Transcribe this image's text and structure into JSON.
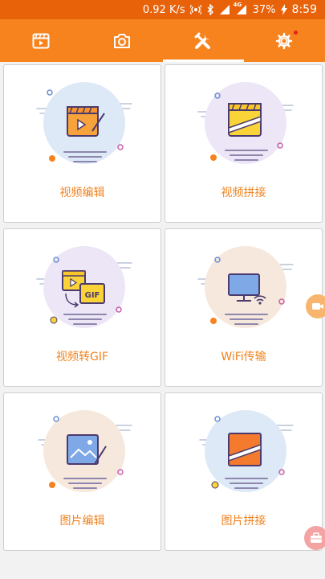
{
  "status_bar": {
    "speed": "0.92 K/s",
    "network": "4G",
    "battery": "37%",
    "time": "8:59"
  },
  "tabs": [
    {
      "icon": "video-clapper-icon",
      "active": false
    },
    {
      "icon": "camera-icon",
      "active": false
    },
    {
      "icon": "tools-icon",
      "active": true
    },
    {
      "icon": "settings-icon",
      "active": false,
      "badge": true
    }
  ],
  "cards": [
    {
      "label": "视频编辑",
      "icon": "video-edit-icon",
      "circle": "#dde9f7"
    },
    {
      "label": "视频拼接",
      "icon": "video-merge-icon",
      "circle": "#ece6f7"
    },
    {
      "label": "视频转GIF",
      "icon": "video-to-gif-icon",
      "circle": "#ece6f7"
    },
    {
      "label": "WiFi传输",
      "icon": "wifi-transfer-icon",
      "circle": "#f6e8dc"
    },
    {
      "label": "图片编辑",
      "icon": "image-edit-icon",
      "circle": "#f6e8dc"
    },
    {
      "label": "图片拼接",
      "icon": "image-merge-icon",
      "circle": "#dde9f7"
    }
  ],
  "colors": {
    "accent": "#f7831e",
    "status_bar": "#e8620a",
    "label": "#f0821e"
  }
}
